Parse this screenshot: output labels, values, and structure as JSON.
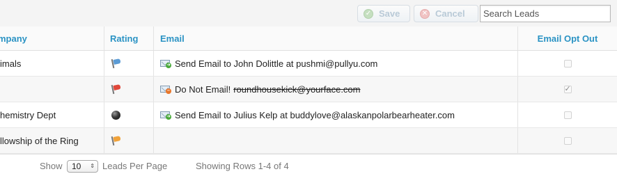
{
  "toolbar": {
    "save_label": "Save",
    "cancel_label": "Cancel",
    "search_placeholder": "Search Leads"
  },
  "table": {
    "columns": {
      "company": "mpany",
      "rating": "Rating",
      "email": "Email",
      "opt_out": "Email Opt Out"
    },
    "rows": [
      {
        "company": "imals",
        "rating": "blue-flag",
        "email_text": "Send Email to John Dolittle at pushmi@pullyu.com",
        "email_icon": "send-email-icon",
        "opt_out": false
      },
      {
        "company": "",
        "rating": "red-flag",
        "email_text": "Do Not Email!",
        "email_struck": "roundhousekick@yourface.com",
        "email_icon": "do-not-email-icon",
        "opt_out": true
      },
      {
        "company": "hemistry Dept",
        "rating": "eight-ball",
        "email_text": "Send Email to Julius Kelp at buddylove@alaskanpolarbearheater.com",
        "email_icon": "send-email-icon",
        "opt_out": false
      },
      {
        "company": "llowship of the Ring",
        "rating": "orange-flag",
        "email_text": "",
        "email_icon": "",
        "opt_out": false
      }
    ]
  },
  "footer": {
    "show_label": "Show",
    "per_page_value": "10",
    "per_page_label": "Leads Per Page",
    "rows_label": "Showing Rows 1-4 of 4"
  },
  "colors": {
    "header_text": "#2b93c4",
    "flag_blue": "#5b9bd5",
    "flag_red": "#e0483b",
    "flag_orange": "#f0a23a"
  }
}
